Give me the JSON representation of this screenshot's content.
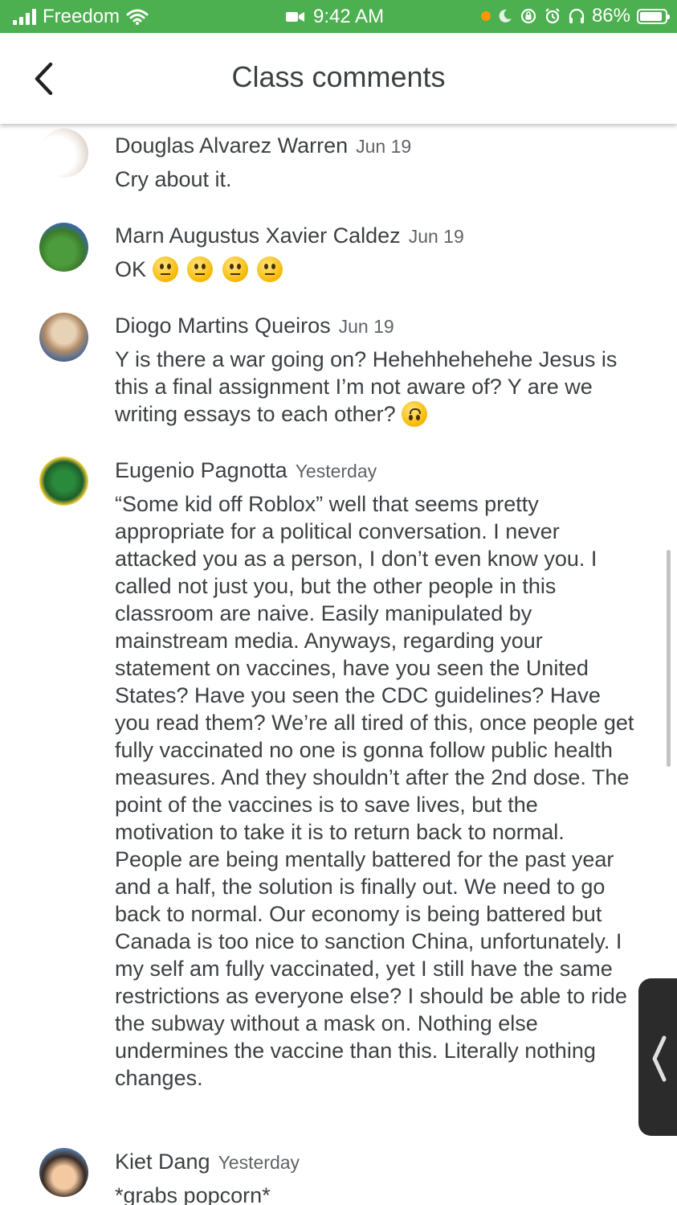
{
  "status_bar": {
    "carrier": "Freedom",
    "time": "9:42 AM",
    "battery": "86%",
    "battery_level": 0.86,
    "status_color": "#4caf50"
  },
  "app_bar": {
    "title": "Class comments",
    "back_icon": "chevron-left-icon"
  },
  "comments": [
    {
      "author": "Douglas Alvarez Warren",
      "date": "Jun 19",
      "text": "Cry about it."
    },
    {
      "author": "Marn Augustus Xavier Caldez",
      "date": "Jun 19",
      "text": "OK",
      "emoji": [
        "neutral-face",
        "neutral-face",
        "neutral-face",
        "neutral-face"
      ]
    },
    {
      "author": "Diogo Martins Queiros",
      "date": "Jun 19",
      "text": "Y is there a war going on? Hehehhehehehe Jesus is this a final assignment I’m not aware of? Y are we writing essays to each other?",
      "emoji": [
        "upside-down-face"
      ]
    },
    {
      "author": "Eugenio Pagnotta",
      "date": "Yesterday",
      "text": "“Some kid off Roblox” well that seems pretty appropriate for a political conversation. I never attacked you as a person, I don’t even know you. I called not just you, but the other people in this classroom are naive. Easily manipulated by mainstream media. Anyways, regarding your statement on vaccines, have you seen the United States? Have you seen the CDC guidelines? Have you read them? We’re all tired of this, once people get fully vaccinated no one is gonna follow public health measures. And they shouldn’t after the 2nd dose. The point of the vaccines is to save lives, but the motivation to take it is to return back to normal. People are being mentally battered for the past year and a half, the solution is finally out. We need to go back to normal. Our economy is being battered but Canada is too nice to sanction China, unfortunately. I my self am fully vaccinated, yet I still have the same restrictions as everyone else? I should be able to ride the subway without a mask on. Nothing else undermines the vaccine than this. Literally nothing changes."
    },
    {
      "author": "Kiet Dang",
      "date": "Yesterday",
      "text": "*grabs popcorn*"
    }
  ]
}
